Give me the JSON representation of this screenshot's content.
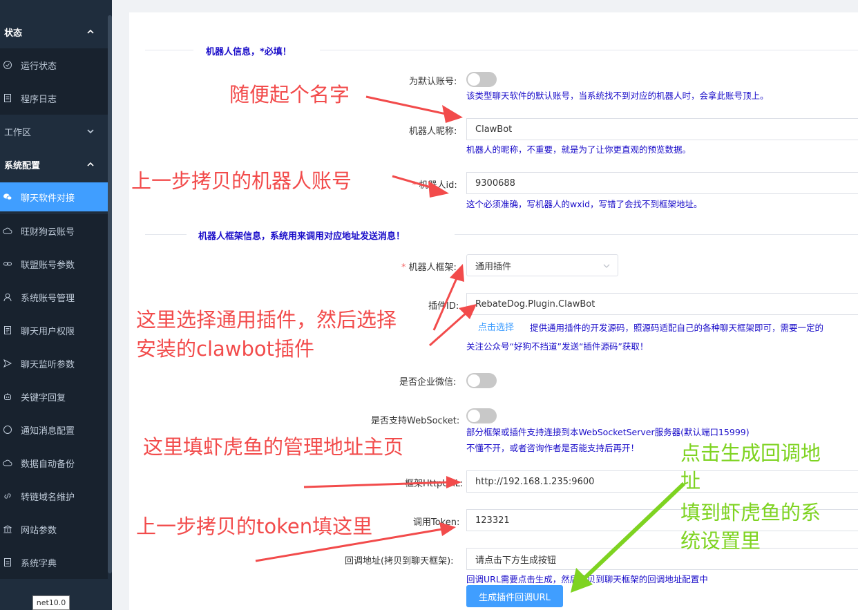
{
  "sidebar": {
    "groups": {
      "status": "状态",
      "workspace": "工作区",
      "system_config": "系统配置"
    },
    "items": {
      "run_status": "运行状态",
      "program_log": "程序日志",
      "chat_software": "聊天软件对接",
      "wangcaigou_account": "旺财狗云账号",
      "alliance_params": "联盟账号参数",
      "system_accounts": "系统账号管理",
      "chat_user_perms": "聊天用户权限",
      "chat_listen_params": "聊天监听参数",
      "keyword_reply": "关键字回复",
      "notify_config": "通知消息配置",
      "auto_backup": "数据自动备份",
      "link_domain": "转链域名维护",
      "site_params": "网站参数",
      "system_dict": "系统字典"
    },
    "version": "net10.0"
  },
  "form": {
    "section1_title": "机器人信息，*必填！",
    "default_account_label": "为默认账号:",
    "default_account_hint": "该类型聊天软件的默认账号，当系统找不到对应的机器人时，会拿此账号顶上。",
    "nickname_label": "机器人昵称:",
    "nickname_value": "ClawBot",
    "nickname_hint": "机器人的昵称，不重要，就是为了让你更直观的预览数据。",
    "robot_id_label": "机器人id:",
    "robot_id_value": "9300688",
    "robot_id_hint": "这个必须准确，写机器人的wxid，写错了会找不到框架地址。",
    "section2_title": "机器人框架信息，系统用来调用对应地址发送消息！",
    "framework_label": "机器人框架:",
    "framework_value": "通用插件",
    "plugin_id_label": "插件ID:",
    "plugin_id_value": "RebateDog.Plugin.ClawBot",
    "click_select": "点击选择",
    "plugin_hint": "提供通用插件的开发源码，照源码适配自己的各种聊天框架即可，需要一定的",
    "plugin_hint2": "关注公众号“好狗不挡道”发送“插件源码”获取！",
    "enterprise_wechat_label": "是否企业微信:",
    "websocket_label": "是否支持WebSocket:",
    "websocket_hint1": "部分框架或插件支持连接到本WebSocketServer服务器(默认端口15999)",
    "websocket_hint2": "不懂不开，或者咨询作者是否能支持后再开！",
    "framework_url_label": "框架HttpURL:",
    "framework_url_value": "http://192.168.1.235:9600",
    "token_label": "调用Token:",
    "token_value": "123321",
    "callback_label": "回调地址(拷贝到聊天框架):",
    "callback_value": "请点击下方生成按钮",
    "callback_hint": "回调URL需要点击生成，然后拷贝到聊天框架的回调地址配置中",
    "generate_button": "生成插件回调URL"
  },
  "annotations": {
    "name": "随便起个名字",
    "robot_account": "上一步拷贝的机器人账号",
    "select_plugin_1": "这里选择通用插件，然后选择",
    "select_plugin_2": "安装的clawbot插件",
    "manage_url": "这里填虾虎鱼的管理地址主页",
    "token": "上一步拷贝的token填这里",
    "green_1": "点击生成回调地",
    "green_2": "址",
    "green_3": "填到虾虎鱼的系",
    "green_4": "统设置里"
  },
  "colors": {
    "sidebar_bg": "#1f2d3d",
    "active_item": "#409eff",
    "hint_text": "#1a0dc9",
    "annotation_red": "#f24b4b",
    "annotation_green": "#7ed321"
  }
}
